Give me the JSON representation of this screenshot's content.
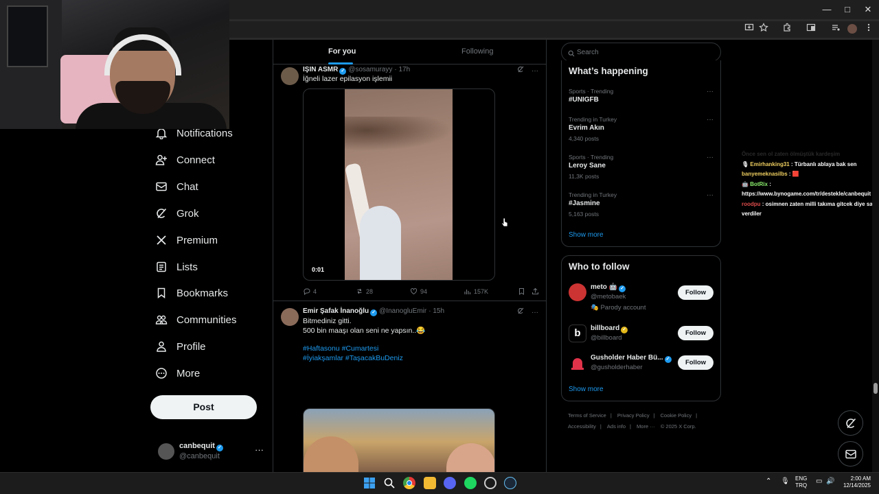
{
  "window": {
    "min": "—",
    "max": "□",
    "close": "✕"
  },
  "nav": {
    "items": [
      {
        "label": "Notifications",
        "icon": "bell-icon"
      },
      {
        "label": "Connect",
        "icon": "person-add-icon"
      },
      {
        "label": "Chat",
        "icon": "mail-icon"
      },
      {
        "label": "Grok",
        "icon": "grok-icon"
      },
      {
        "label": "Premium",
        "icon": "x-logo-icon"
      },
      {
        "label": "Lists",
        "icon": "list-icon"
      },
      {
        "label": "Bookmarks",
        "icon": "bookmark-icon"
      },
      {
        "label": "Communities",
        "icon": "people-icon"
      },
      {
        "label": "Profile",
        "icon": "person-icon"
      },
      {
        "label": "More",
        "icon": "more-circle-icon"
      }
    ],
    "post_label": "Post"
  },
  "account": {
    "name": "canbequit",
    "handle": "@canbequit",
    "more": "···"
  },
  "tabs": {
    "for_you": "For you",
    "following": "Following"
  },
  "tweets": [
    {
      "name": "IŞIN ASMR",
      "handle": "@sosamurayy",
      "time": "· 17h",
      "text": "İğneli lazer epilasyon işlemii",
      "video_time": "0:01",
      "replies": "4",
      "reposts": "28",
      "likes": "94",
      "views": "157K"
    },
    {
      "name": "Emir Şafak İnanoğlu",
      "handle": "@InanogluEmir",
      "time": "· 15h",
      "line1": "Bitmediniz gitti.",
      "line2": "500 bin maaşı olan seni ne yapsın..😂",
      "hashtags1": "#Haftasonu #Cumartesi",
      "hashtags2": "#İyiakşamlar #TaşacakBuDeniz"
    }
  ],
  "search": {
    "placeholder": "Search"
  },
  "trends": {
    "title": "What’s happening",
    "items": [
      {
        "context": "Sports · Trending",
        "name": "#UNIGFB",
        "count": ""
      },
      {
        "context": "Trending in Turkey",
        "name": "Evrim Akın",
        "count": "4,340 posts"
      },
      {
        "context": "Sports · Trending",
        "name": "Leroy Sane",
        "count": "11,3K posts"
      },
      {
        "context": "Trending in Turkey",
        "name": "#Jasmine",
        "count": "5,163 posts"
      }
    ],
    "more_dots": "···",
    "show_more": "Show more"
  },
  "who_to_follow": {
    "title": "Who to follow",
    "items": [
      {
        "name": "meto 🤖",
        "handle": "@metobaek",
        "badge": "🎭 Parody account",
        "follow": "Follow"
      },
      {
        "name": "billboard",
        "handle": "@billboard",
        "badge": "",
        "follow": "Follow"
      },
      {
        "name": "Gusholder Haber Bü...",
        "handle": "@gusholderhaber",
        "badge": "",
        "follow": "Follow"
      }
    ],
    "show_more": "Show more"
  },
  "footer": {
    "terms": "Terms of Service",
    "privacy": "Privacy Policy",
    "cookie": "Cookie Policy",
    "accessibility": "Accessibility",
    "ads": "Ads info",
    "more": "More ···",
    "copyright": "© 2025 X Corp."
  },
  "chat": {
    "header": "Önce sen ol zaten ölmüştük kardeşim",
    "messages": [
      {
        "user": "Emirhanking31",
        "sep": " : ",
        "text": "Türbanlı ablaya bak sen"
      },
      {
        "user": "banyemeknasilbs",
        "sep": " : ",
        "text": "🟥"
      },
      {
        "user": "BotRix",
        "sep": " : ",
        "text": "https://www.bynogame.com/tr/destekle/canbequit"
      },
      {
        "user": "roodpu",
        "sep": " : ",
        "text": "osimnen zaten milli takıma gitcek diye sarıl verdiler"
      }
    ]
  },
  "taskbar": {
    "lang1": "ENG",
    "lang2": "TRQ",
    "time": "2:00 AM",
    "date": "12/14/2025"
  },
  "colors": {
    "accent": "#1d9bf0",
    "background": "#000000",
    "border": "#2f3336",
    "muted": "#71767b"
  }
}
